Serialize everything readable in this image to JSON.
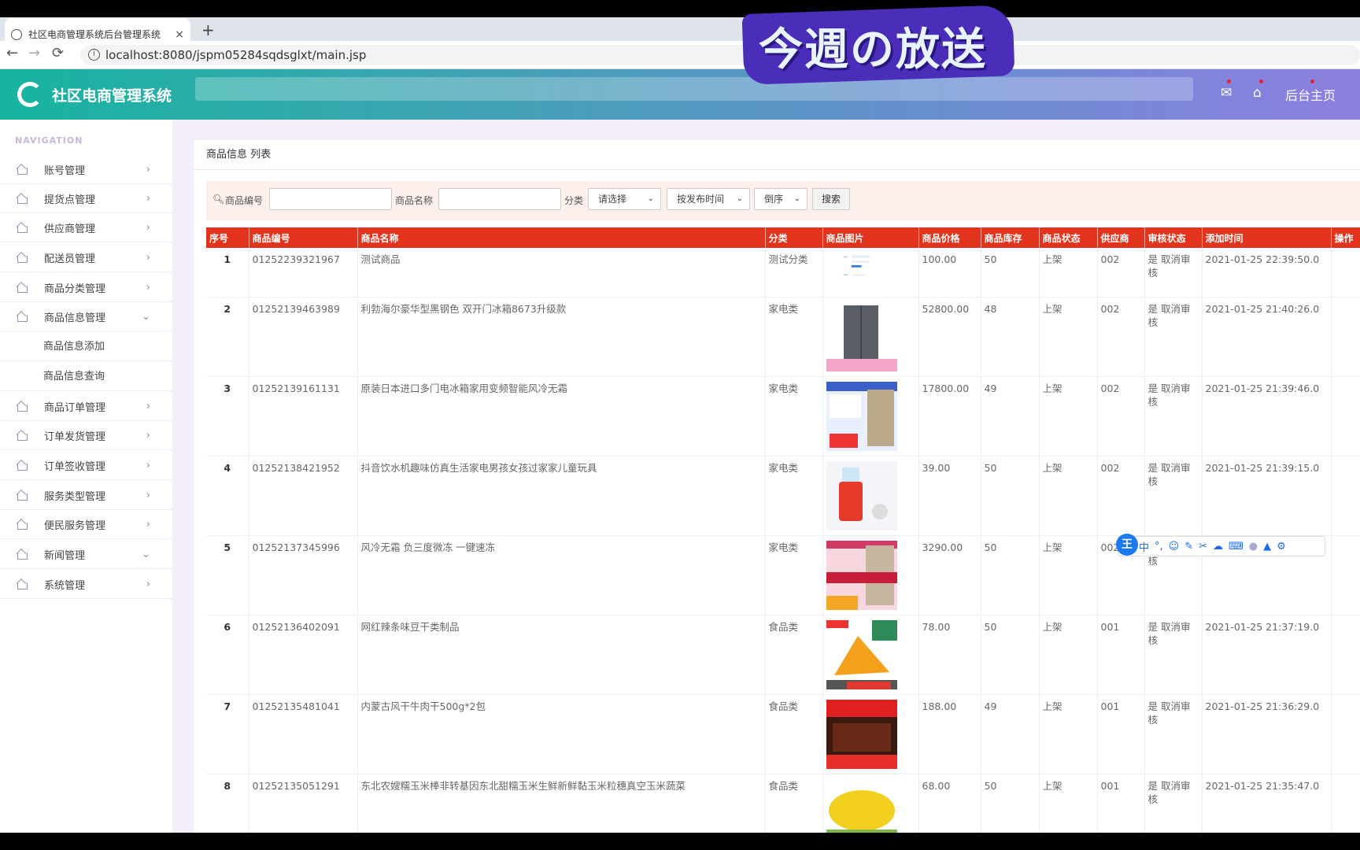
{
  "browser": {
    "tab_title": "社区电商管理系统后台管理系统",
    "tab_close": "×",
    "new_tab": "+",
    "url": "localhost:8080/jspm05284sqdsglxt/main.jsp",
    "back": "←",
    "forward": "→",
    "reload": "⟳",
    "info": "i"
  },
  "overlay": {
    "stamp_text": "今週の放送"
  },
  "header": {
    "logo_text": "社区电商管理系统",
    "home_link": "后台主页"
  },
  "sidebar": {
    "heading": "NAVIGATION",
    "items": [
      {
        "label": "账号管理",
        "chev": "›"
      },
      {
        "label": "提货点管理",
        "chev": "›"
      },
      {
        "label": "供应商管理",
        "chev": "›"
      },
      {
        "label": "配送员管理",
        "chev": "›"
      },
      {
        "label": "商品分类管理",
        "chev": "›"
      },
      {
        "label": "商品信息管理",
        "chev": "⌄"
      },
      {
        "label": "商品订单管理",
        "chev": "›"
      },
      {
        "label": "订单发货管理",
        "chev": "›"
      },
      {
        "label": "订单签收管理",
        "chev": "›"
      },
      {
        "label": "服务类型管理",
        "chev": "›"
      },
      {
        "label": "便民服务管理",
        "chev": "›"
      },
      {
        "label": "新闻管理",
        "chev": "⌄"
      },
      {
        "label": "系统管理",
        "chev": "›"
      }
    ],
    "subitems": [
      "商品信息添加",
      "商品信息查询"
    ]
  },
  "panel": {
    "title": "商品信息 列表"
  },
  "filter": {
    "code_label": "商品编号",
    "name_label": "商品名称",
    "category_label": "分类",
    "category_select": "请选择",
    "sort_select": "按发布时间",
    "order_select": "倒序",
    "search_button": "搜索",
    "arrow": "⌄"
  },
  "table": {
    "headers": [
      "序号",
      "商品编号",
      "商品名称",
      "分类",
      "商品图片",
      "商品价格",
      "商品库存",
      "商品状态",
      "供应商",
      "审核状态",
      "添加时间",
      "操作"
    ],
    "rows": [
      {
        "idx": "1",
        "code": "01252239321967",
        "name": "测试商品",
        "category": "测试分类",
        "price": "100.00",
        "stock": "50",
        "status": "上架",
        "supplier": "002",
        "audit": "是 取消审核",
        "time": "2021-01-25 22:39:50.0"
      },
      {
        "idx": "2",
        "code": "01252139463989",
        "name": "利勃海尔豪华型黑钢色 双开门冰箱8673升级款",
        "category": "家电类",
        "price": "52800.00",
        "stock": "48",
        "status": "上架",
        "supplier": "002",
        "audit": "是 取消审核",
        "time": "2021-01-25 21:40:26.0"
      },
      {
        "idx": "3",
        "code": "01252139161131",
        "name": "原装日本进口多门电冰箱家用变频智能风冷无霜",
        "category": "家电类",
        "price": "17800.00",
        "stock": "49",
        "status": "上架",
        "supplier": "002",
        "audit": "是 取消审核",
        "time": "2021-01-25 21:39:46.0"
      },
      {
        "idx": "4",
        "code": "01252138421952",
        "name": "抖音饮水机趣味仿真生活家电男孩女孩过家家儿童玩具",
        "category": "家电类",
        "price": "39.00",
        "stock": "50",
        "status": "上架",
        "supplier": "002",
        "audit": "是 取消审核",
        "time": "2021-01-25 21:39:15.0"
      },
      {
        "idx": "5",
        "code": "01252137345996",
        "name": "风冷无霜 负三度微冻 一键速冻",
        "category": "家电类",
        "price": "3290.00",
        "stock": "50",
        "status": "上架",
        "supplier": "002",
        "audit": "是 取消审核",
        "time": ""
      },
      {
        "idx": "6",
        "code": "01252136402091",
        "name": "网红辣条味豆干类制品",
        "category": "食品类",
        "price": "78.00",
        "stock": "50",
        "status": "上架",
        "supplier": "001",
        "audit": "是 取消审核",
        "time": "2021-01-25 21:37:19.0"
      },
      {
        "idx": "7",
        "code": "01252135481041",
        "name": "内蒙古风干牛肉干500g*2包",
        "category": "食品类",
        "price": "188.00",
        "stock": "49",
        "status": "上架",
        "supplier": "001",
        "audit": "是 取消审核",
        "time": "2021-01-25 21:36:29.0"
      },
      {
        "idx": "8",
        "code": "01252135051291",
        "name": "东北农嫂糯玉米棒非转基因东北甜糯玉米生鲜新鲜黏玉米粒穗真空玉米蔬菜",
        "category": "食品类",
        "price": "68.00",
        "stock": "50",
        "status": "上架",
        "supplier": "001",
        "audit": "是 取消审核",
        "time": "2021-01-25 21:35:47.0"
      }
    ]
  },
  "ime": {
    "logo": "王",
    "mode": "中"
  },
  "colors": {
    "table_header": "#e2331c",
    "header_start": "#17b4a0",
    "header_end": "#8d7fe0",
    "stamp": "#4a2db8"
  }
}
